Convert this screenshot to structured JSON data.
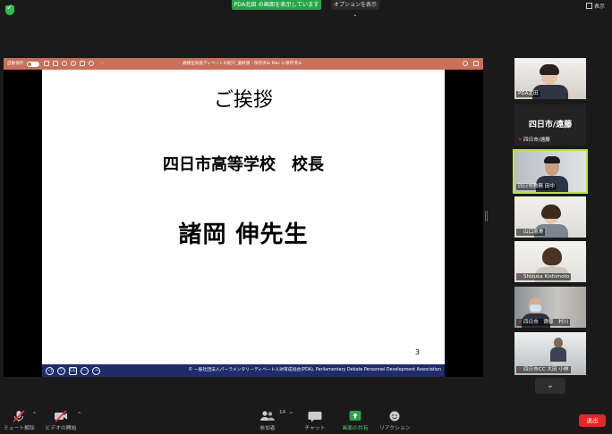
{
  "topbar": {
    "share_banner": "PDA北田 の画面を表示しています",
    "options_label": "オプションを表示",
    "view_label": "表示"
  },
  "presentation": {
    "header_left": "自動保存",
    "header_title": "規模型高能ディベートの紹介_最終版 · 保存済み Mac に保存済み",
    "slide_title": "ご挨拶",
    "slide_subtitle": "四日市高等学校　校長",
    "slide_name": "諸岡 伸先生",
    "page_number": "3",
    "footer_text": "© 一般社団法人パーラメンタリーディベート人財育成協会(PDA), Parliamentary Debate Personnel Development Association",
    "footer_nav": [
      "◁",
      "▽",
      "CC",
      "···",
      "→"
    ]
  },
  "participants": [
    {
      "name": "PDA北田",
      "muted": false
    },
    {
      "name": "四日市/遠藤",
      "display_name": "四日市/遠藤",
      "muted": true
    },
    {
      "name": "四日市教務 田中",
      "muted": false,
      "active": true
    },
    {
      "name": "山口恵美",
      "muted": true
    },
    {
      "name": "Shizuka Kishimoto",
      "muted": true
    },
    {
      "name": "四日市　齊藤　村川",
      "muted": true
    },
    {
      "name": "四日市CC 大田 小林",
      "muted": true
    }
  ],
  "toolbar": {
    "mute": "ミュート解除",
    "video": "ビデオの開始",
    "participants": "参加者",
    "participants_count": "14",
    "chat": "チャット",
    "share": "画面の共有",
    "reactions": "リアクション",
    "end": "退出"
  },
  "colors": {
    "share_green": "#2aa34a",
    "ppt_bar": "#c8705a",
    "slide_footer": "#1f2b6b",
    "end_red": "#e02828",
    "active_speaker": "#b8e04a"
  }
}
